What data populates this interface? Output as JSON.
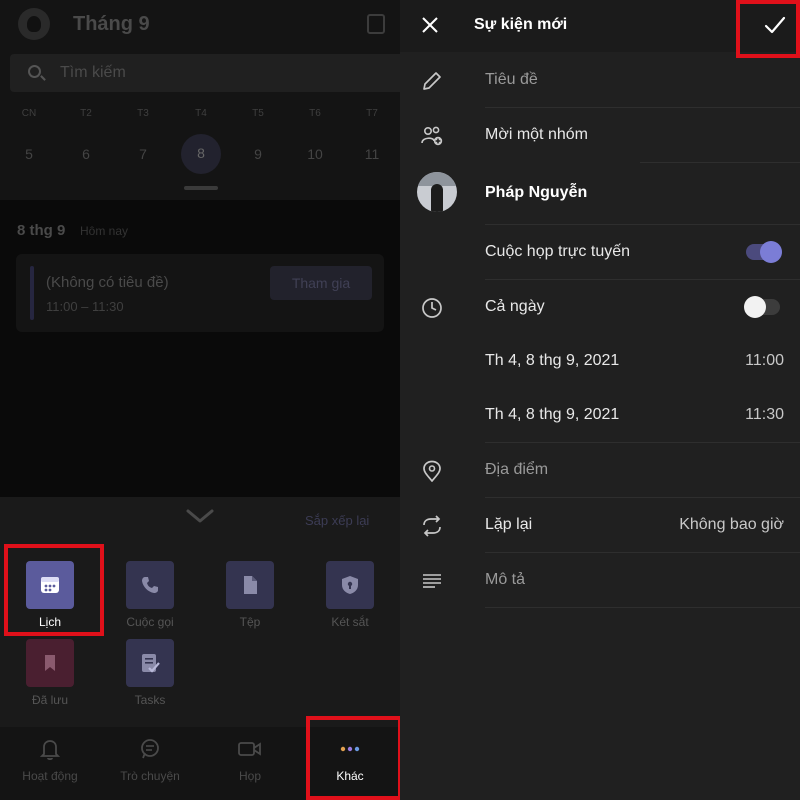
{
  "calendar": {
    "month_title": "Tháng 9",
    "search_placeholder": "Tìm kiếm",
    "weekdays": [
      "CN",
      "T2",
      "T3",
      "T4",
      "T5",
      "T6",
      "T7"
    ],
    "days": [
      "5",
      "6",
      "7",
      "8",
      "9",
      "10",
      "11"
    ],
    "selected_day": "8",
    "date_heading": "8 thg 9",
    "today_label": "Hôm nay",
    "event": {
      "title": "(Không có tiêu đề)",
      "time": "11:00 – 11:30",
      "join_label": "Tham gia"
    }
  },
  "apps_sheet": {
    "reorder_label": "Sắp xếp lại",
    "apps": [
      {
        "label": "Lịch",
        "icon": "calendar-icon",
        "active": true
      },
      {
        "label": "Cuộc gọi",
        "icon": "phone-icon"
      },
      {
        "label": "Tệp",
        "icon": "file-icon"
      },
      {
        "label": "Két sắt",
        "icon": "vault-icon"
      },
      {
        "label": "Đã lưu",
        "icon": "bookmark-icon"
      },
      {
        "label": "Tasks",
        "icon": "tasks-icon"
      }
    ]
  },
  "bottom_nav": {
    "items": [
      {
        "label": "Hoạt động",
        "icon": "bell-icon"
      },
      {
        "label": "Trò chuyện",
        "icon": "chat-icon"
      },
      {
        "label": "Họp",
        "icon": "video-icon"
      },
      {
        "label": "Khác",
        "icon": "more-icon",
        "active": true
      }
    ]
  },
  "new_event": {
    "header_title": "Sự kiện mới",
    "title_placeholder": "Tiêu đề",
    "invite_group": "Mời một nhóm",
    "organizer": "Pháp Nguyễn",
    "online_meeting_label": "Cuộc họp trực tuyến",
    "online_meeting_on": true,
    "all_day_label": "Cả ngày",
    "all_day_on": false,
    "start": {
      "date": "Th 4, 8 thg 9, 2021",
      "time": "11:00"
    },
    "end": {
      "date": "Th 4, 8 thg 9, 2021",
      "time": "11:30"
    },
    "location_placeholder": "Địa điểm",
    "repeat_label": "Lặp lại",
    "repeat_value": "Không bao giờ",
    "description_placeholder": "Mô tả"
  },
  "colors": {
    "accent": "#7b7dd6",
    "highlight_box": "#e0101a",
    "panel_bg": "#202020"
  }
}
